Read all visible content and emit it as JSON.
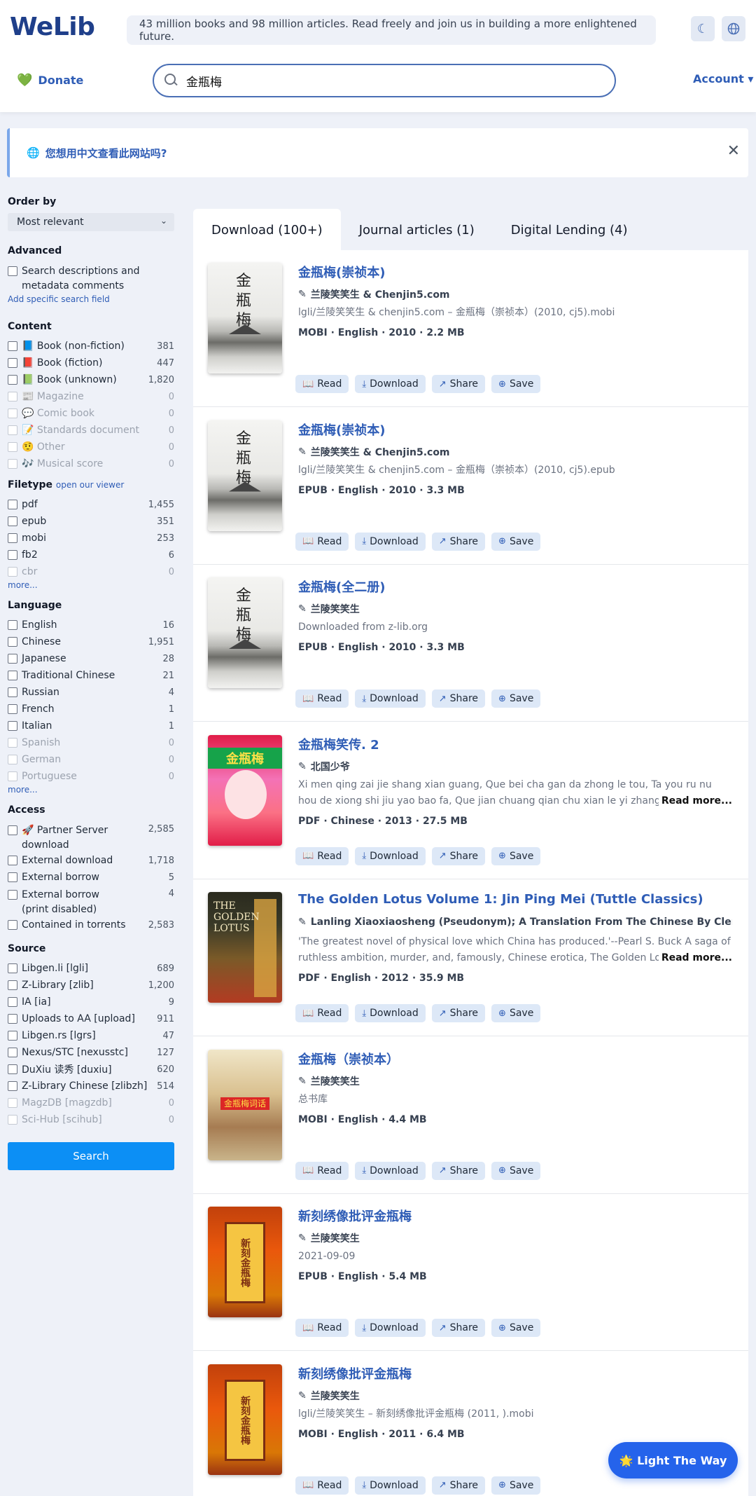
{
  "header": {
    "logo": "WeLib",
    "announcement": "43 million books and 98 million articles. Read freely and join us in building a more enlightened future.",
    "donate_label": "Donate",
    "search_value": "金瓶梅",
    "account_label": "Account ▾"
  },
  "lang_banner": {
    "text": "您想用中文查看此网站吗?"
  },
  "sidebar": {
    "order_by_title": "Order by",
    "order_by_value": "Most relevant",
    "advanced_title": "Advanced",
    "advanced_option": "Search descriptions and metadata comments",
    "add_field_link": "Add specific search field",
    "content_title": "Content",
    "content": [
      {
        "label": "📘 Book (non-fiction)",
        "count": "381",
        "dim": false
      },
      {
        "label": "📕 Book (fiction)",
        "count": "447",
        "dim": false
      },
      {
        "label": "📗 Book (unknown)",
        "count": "1,820",
        "dim": false
      },
      {
        "label": "📰 Magazine",
        "count": "0",
        "dim": true
      },
      {
        "label": "💬 Comic book",
        "count": "0",
        "dim": true
      },
      {
        "label": "📝 Standards document",
        "count": "0",
        "dim": true
      },
      {
        "label": "🤨 Other",
        "count": "0",
        "dim": true
      },
      {
        "label": "🎶 Musical score",
        "count": "0",
        "dim": true
      }
    ],
    "filetype_title": "Filetype",
    "filetype_link": "open our viewer",
    "filetype": [
      {
        "label": "pdf",
        "count": "1,455",
        "dim": false
      },
      {
        "label": "epub",
        "count": "351",
        "dim": false
      },
      {
        "label": "mobi",
        "count": "253",
        "dim": false
      },
      {
        "label": "fb2",
        "count": "6",
        "dim": false
      },
      {
        "label": "cbr",
        "count": "0",
        "dim": true
      }
    ],
    "more_label": "more...",
    "language_title": "Language",
    "language": [
      {
        "label": "English",
        "count": "16",
        "dim": false
      },
      {
        "label": "Chinese",
        "count": "1,951",
        "dim": false
      },
      {
        "label": "Japanese",
        "count": "28",
        "dim": false
      },
      {
        "label": "Traditional Chinese",
        "count": "21",
        "dim": false
      },
      {
        "label": "Russian",
        "count": "4",
        "dim": false
      },
      {
        "label": "French",
        "count": "1",
        "dim": false
      },
      {
        "label": "Italian",
        "count": "1",
        "dim": false
      },
      {
        "label": "Spanish",
        "count": "0",
        "dim": true
      },
      {
        "label": "German",
        "count": "0",
        "dim": true
      },
      {
        "label": "Portuguese",
        "count": "0",
        "dim": true
      }
    ],
    "access_title": "Access",
    "access": [
      {
        "label": "🚀 Partner Server download",
        "count": "2,585",
        "dim": false,
        "tall": true
      },
      {
        "label": "External download",
        "count": "1,718",
        "dim": false,
        "tall": false
      },
      {
        "label": "External borrow",
        "count": "5",
        "dim": false,
        "tall": false
      },
      {
        "label": "External borrow (print disabled)",
        "count": "4",
        "dim": false,
        "tall": true
      },
      {
        "label": "Contained in torrents",
        "count": "2,583",
        "dim": false,
        "tall": false
      }
    ],
    "source_title": "Source",
    "source": [
      {
        "label": "Libgen.li [lgli]",
        "count": "689",
        "dim": false
      },
      {
        "label": "Z-Library [zlib]",
        "count": "1,200",
        "dim": false
      },
      {
        "label": "IA [ia]",
        "count": "9",
        "dim": false
      },
      {
        "label": "Uploads to AA [upload]",
        "count": "911",
        "dim": false
      },
      {
        "label": "Libgen.rs [lgrs]",
        "count": "47",
        "dim": false
      },
      {
        "label": "Nexus/STC [nexusstc]",
        "count": "127",
        "dim": false
      },
      {
        "label": "DuXiu 读秀 [duxiu]",
        "count": "620",
        "dim": false
      },
      {
        "label": "Z-Library Chinese [zlibzh]",
        "count": "514",
        "dim": false
      },
      {
        "label": "MagzDB [magzdb]",
        "count": "0",
        "dim": true
      },
      {
        "label": "Sci-Hub [scihub]",
        "count": "0",
        "dim": true
      }
    ],
    "search_button": "Search"
  },
  "tabs": [
    {
      "label": "Download (100+)",
      "active": true
    },
    {
      "label": "Journal articles (1)",
      "active": false
    },
    {
      "label": "Digital Lending (4)",
      "active": false
    }
  ],
  "actions": {
    "read": "Read",
    "download": "Download",
    "share": "Share",
    "save": "Save"
  },
  "read_more": "Read more...",
  "results": [
    {
      "title": "金瓶梅(崇祯本)",
      "author": "兰陵笑笑生 & Chenjin5.com",
      "desc": "lgli/兰陵笑笑生 & chenjin5.com – 金瓶梅（崇祯本）(2010, cj5).mobi",
      "meta": "MOBI · English · 2010 · 2.2 MB",
      "cover": "ink",
      "desc_lines": 1
    },
    {
      "title": "金瓶梅(崇祯本)",
      "author": "兰陵笑笑生 & Chenjin5.com",
      "desc": "lgli/兰陵笑笑生 & chenjin5.com – 金瓶梅（崇祯本）(2010, cj5).epub",
      "meta": "EPUB · English · 2010 · 3.3 MB",
      "cover": "ink",
      "desc_lines": 1
    },
    {
      "title": "金瓶梅(全二册)",
      "author": "兰陵笑笑生",
      "desc": "Downloaded from z-lib.org",
      "meta": "EPUB · English · 2010 · 3.3 MB",
      "cover": "ink",
      "desc_lines": 1
    },
    {
      "title": "金瓶梅笑传. 2",
      "author": "北国少爷",
      "desc": "Xi men qing zai jie shang xian guang, Que bei cha gan da zhong le tou, Ta you ru nu hou de xiong shi jiu yao bao fa, Que jian chuang qian chu xian le yi zhang xian nü ban de",
      "meta": "PDF · Chinese · 2013 · 27.5 MB",
      "cover": "pink",
      "desc_lines": 2
    },
    {
      "title": "The Golden Lotus Volume 1: Jin Ping Mei (Tuttle Classics)",
      "author": "Lanling Xiaoxiaosheng (Pseudonym); A Translation From The Chinese By Clement...",
      "desc": "'The greatest novel of physical love which China has produced.'--Pearl S. Buck A saga of ruthless ambition, murder, and, famously, Chinese erotica, The Golden Lotus (al",
      "meta": "PDF · English · 2012 · 35.9 MB",
      "cover": "gold",
      "desc_lines": 2
    },
    {
      "title": "金瓶梅（崇祯本）",
      "author": "兰陵笑笑生",
      "desc": "总书库",
      "meta": "MOBI · English · 4.4 MB",
      "cover": "beige",
      "desc_lines": 1
    },
    {
      "title": "新刻绣像批评金瓶梅",
      "author": "兰陵笑笑生",
      "desc": "2021-09-09",
      "meta": "EPUB · English · 5.4 MB",
      "cover": "orange",
      "desc_lines": 1
    },
    {
      "title": "新刻绣像批评金瓶梅",
      "author": "兰陵笑笑生",
      "desc": "lgli/兰陵笑笑生 – 新刻绣像批评金瓶梅 (2011, ).mobi",
      "meta": "MOBI · English · 2011 · 6.4 MB",
      "cover": "orange",
      "desc_lines": 1
    }
  ],
  "cover_texts": {
    "ink_title": "金瓶梅",
    "pink_banner": "金瓶梅",
    "gold_title": "THE GOLDEN LOTUS",
    "beige_banner": "金瓶梅词话",
    "orange_label": "新刻金瓶梅"
  },
  "float_button": "🌟 Light The Way",
  "colors": {
    "accent": "#2f5db6",
    "search_button": "#0c8ff5",
    "float_button": "#2563eb",
    "action_bg": "#dde8f7"
  }
}
